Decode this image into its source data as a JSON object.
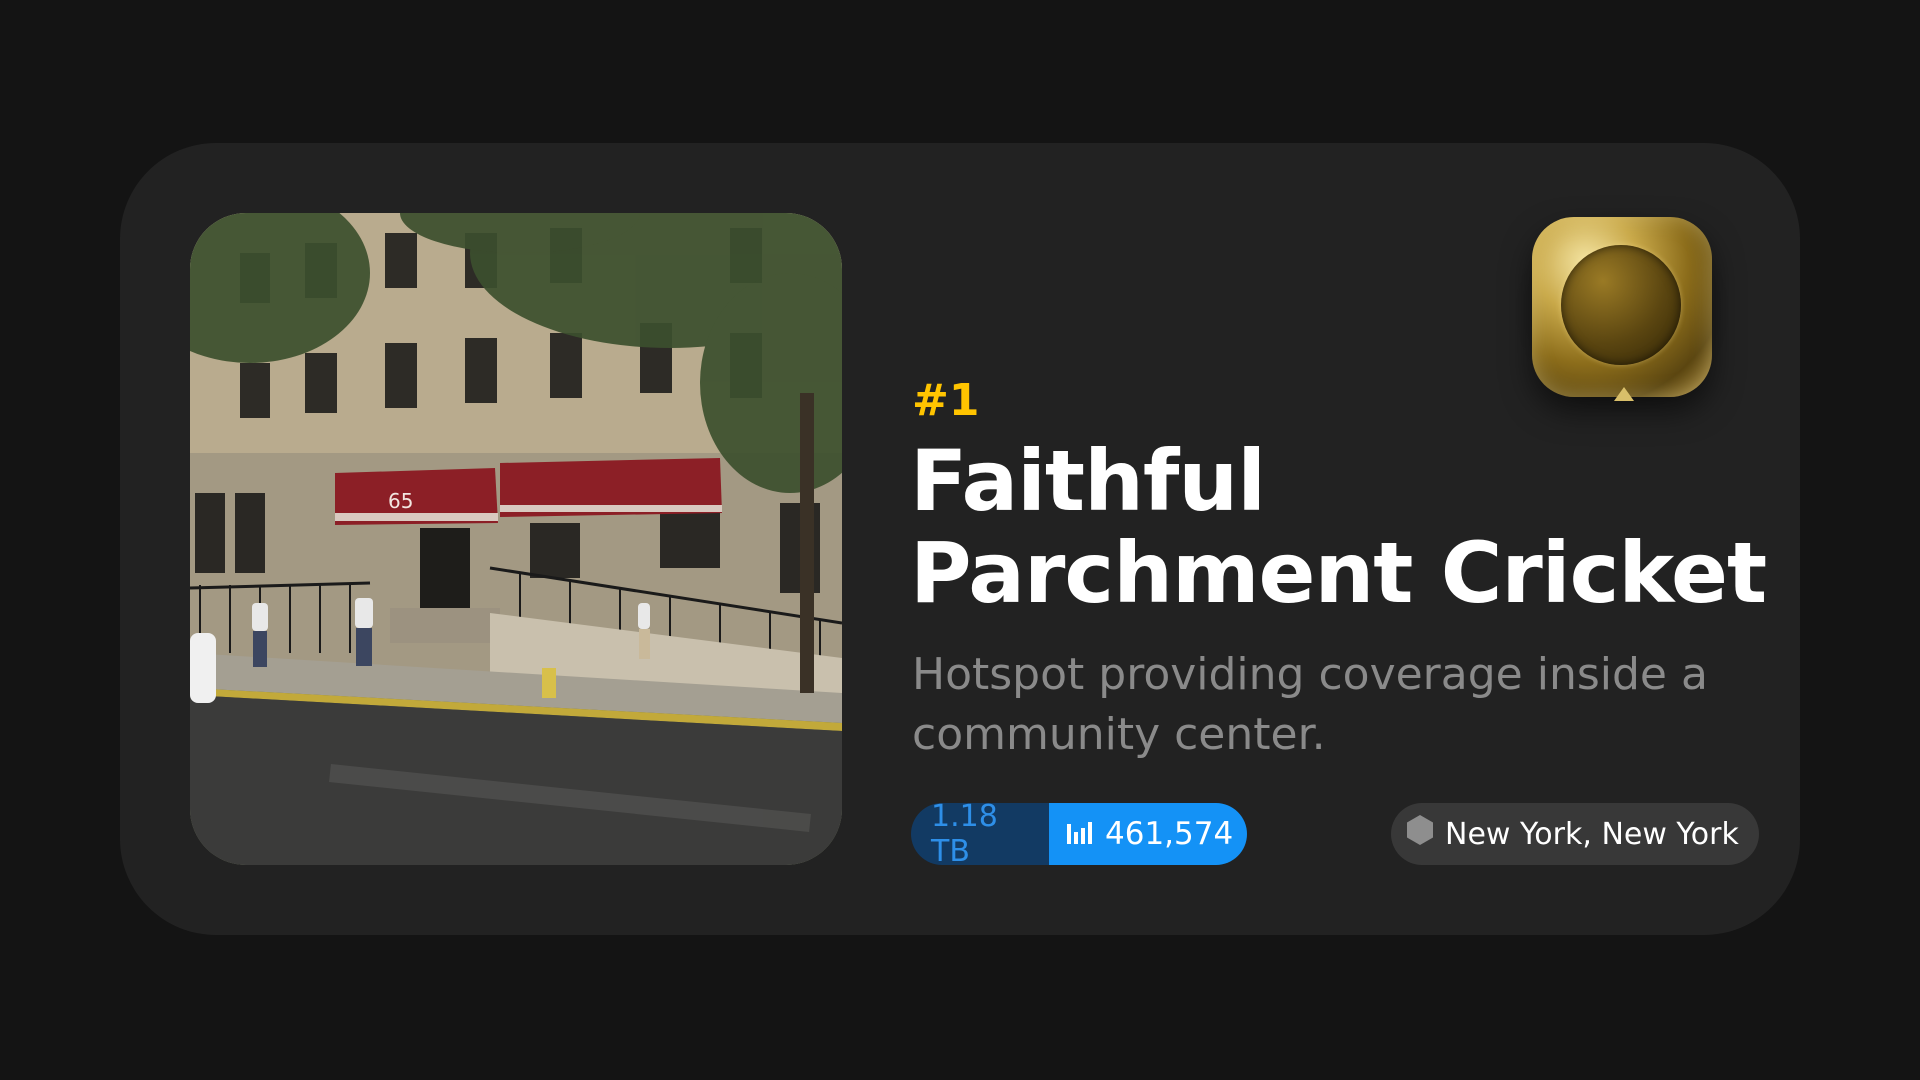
{
  "hotspot": {
    "rank": "#1",
    "name_line1": "Faithful",
    "name_line2": "Parchment Cricket",
    "description": "Hotspot providing coverage inside a community center.",
    "data_transferred": "1.18 TB",
    "count": "461,574",
    "location": "New York, New York",
    "building_number": "65"
  },
  "icons": {
    "count_icon": "bar-chart-icon",
    "location_icon": "hexagon-icon",
    "badge": "gold-medal-badge"
  },
  "colors": {
    "background": "#141414",
    "card": "#222222",
    "rank": "#ffc400",
    "title": "#ffffff",
    "description": "#8a8a8a",
    "tb_pill_bg": "#123a63",
    "tb_pill_text": "#2e8fe8",
    "count_pill_bg": "#1492f6",
    "location_pill_bg": "#383838"
  }
}
